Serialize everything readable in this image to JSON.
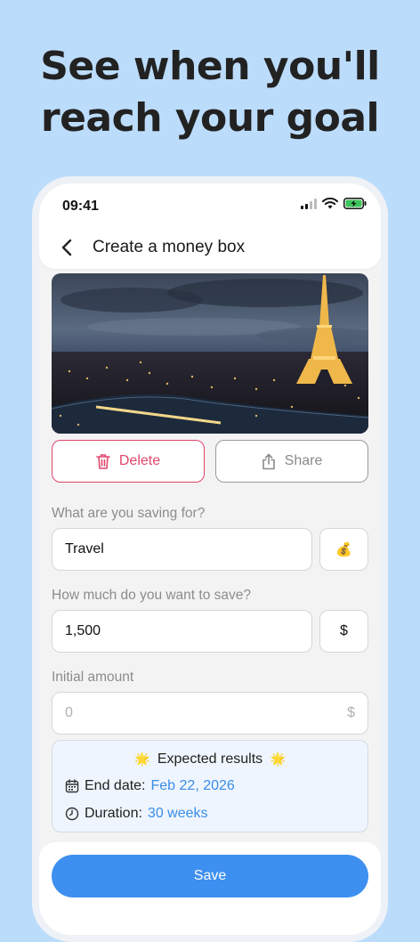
{
  "headline": {
    "line1": "See when you'll",
    "line2": "reach your goal"
  },
  "status_bar": {
    "time": "09:41",
    "icons": [
      "signal-icon",
      "wifi-icon",
      "battery-charging-icon"
    ]
  },
  "nav": {
    "back_icon": "chevron-left-icon",
    "title": "Create a money box"
  },
  "photo": {
    "description_icon": "eiffel-tower-photo"
  },
  "actions": {
    "delete_label": "Delete",
    "delete_icon": "trash-icon",
    "share_label": "Share",
    "share_icon": "share-icon"
  },
  "form": {
    "goal_label": "What are you saving for?",
    "goal_value": "Travel",
    "goal_emoji": "💰",
    "amount_label": "How much do you want to save?",
    "amount_value": "1,500",
    "currency": "$",
    "initial_label": "Initial amount",
    "initial_placeholder": "0",
    "initial_currency": "$"
  },
  "results": {
    "title": "Expected results",
    "sparkle": "🌟",
    "end_date_label": "End date:",
    "end_date_value": "Feb 22, 2026",
    "duration_label": "Duration:",
    "duration_value": "30 weeks"
  },
  "save_label": "Save",
  "colors": {
    "background": "#bcdcfb",
    "accent": "#3d8ff0",
    "delete": "#e0456b",
    "results_bg": "#eef5fe"
  }
}
